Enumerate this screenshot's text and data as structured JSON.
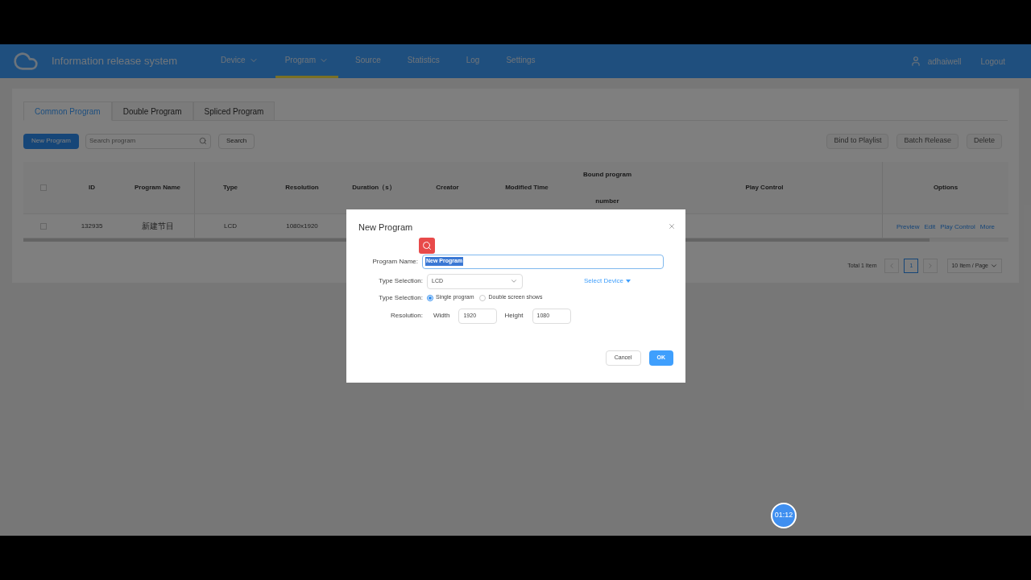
{
  "header": {
    "brand": "Information release system",
    "nav": [
      {
        "label": "Device",
        "dropdown": true,
        "selected": false
      },
      {
        "label": "Program",
        "dropdown": true,
        "selected": true
      },
      {
        "label": "Source",
        "dropdown": false,
        "selected": false
      },
      {
        "label": "Statistics",
        "dropdown": false,
        "selected": false
      },
      {
        "label": "Log",
        "dropdown": false,
        "selected": false
      },
      {
        "label": "Settings",
        "dropdown": false,
        "selected": false
      }
    ],
    "user": "adhaiwell",
    "logout": "Logout"
  },
  "tabs": [
    {
      "label": "Common Program",
      "selected": true
    },
    {
      "label": "Double Program",
      "selected": false
    },
    {
      "label": "Spliced Program",
      "selected": false
    }
  ],
  "toolbar": {
    "new_button": "New Program",
    "search_placeholder": "Search program",
    "search_button": "Search",
    "actions": [
      {
        "label": "Bind to Playlist",
        "disabled": true
      },
      {
        "label": "Batch Release",
        "disabled": true
      },
      {
        "label": "Delete",
        "disabled": true
      }
    ]
  },
  "table": {
    "select_all_checked": false,
    "columns": [
      "ID",
      "Program Name",
      "Type",
      "Resolution",
      "Duration（s）",
      "Creator",
      "Modified Time",
      "Bound program number",
      "Play Control",
      "Options"
    ],
    "rows": [
      {
        "checked": false,
        "cells": [
          "132935",
          "新建节目",
          "LCD",
          "1080x1920"
        ],
        "options": [
          "Preview",
          "Edit",
          "Play Control",
          "More"
        ]
      }
    ]
  },
  "pagination": {
    "total": "Total 1 Item",
    "pages": [
      {
        "label": "1",
        "selected": true
      }
    ],
    "page_size": "10 Item / Page"
  },
  "dialog": {
    "title": "New Program",
    "name_label": "Program Name:",
    "name_value": "New Program",
    "type_label": "Type Selection:",
    "type_value": "LCD",
    "select_device": "Select Device",
    "mode_label": "Type Selection:",
    "modes": [
      {
        "label": "Single program",
        "selected": true
      },
      {
        "label": "Double screen shows",
        "selected": false
      }
    ],
    "resolution_label": "Resolution:",
    "width_label": "Width",
    "width_value": "1920",
    "height_label": "Height",
    "height_value": "1080",
    "cancel": "Cancel",
    "ok": "OK"
  },
  "timer": "01:12"
}
